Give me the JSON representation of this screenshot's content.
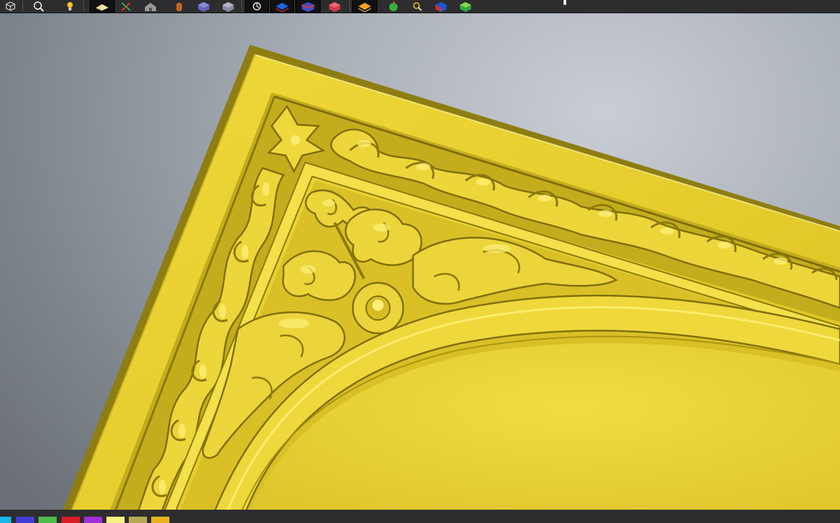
{
  "toolbar": {
    "buttons": [
      {
        "name": "view-cube-icon"
      },
      {
        "name": "zoom-icon"
      },
      {
        "name": "light-bulb-icon"
      },
      {
        "name": "material-shade-icon",
        "selected": true
      },
      {
        "name": "axis-icon"
      },
      {
        "name": "house-icon"
      },
      {
        "name": "cylinder-icon"
      },
      {
        "name": "purple-box-icon"
      },
      {
        "name": "gray-box-icon"
      },
      {
        "name": "rotate-view-icon",
        "selected": true
      },
      {
        "name": "blue-layer-icon",
        "selected": true
      },
      {
        "name": "red-blue-box-icon",
        "selected": true
      },
      {
        "name": "red-box-icon"
      },
      {
        "name": "orange-layer-icon",
        "selected": true
      },
      {
        "name": "green-ball-icon"
      },
      {
        "name": "magnifier-star-icon"
      },
      {
        "name": "blue-cube-icon"
      },
      {
        "name": "green-cube-icon"
      }
    ]
  },
  "viewport": {
    "background": "#aab0b8",
    "model_color": "#e3cc2b",
    "model_shadow": "#8f7f10",
    "model_highlight": "#fff27a",
    "description_name": "relief-frame-model"
  },
  "palette": {
    "swatches": [
      "#16b8e6",
      "#3f3fd8",
      "#4cbc4c",
      "#d81d24",
      "#a02fd6",
      "#f5f184",
      "#b5a954",
      "#e9b21c"
    ]
  }
}
